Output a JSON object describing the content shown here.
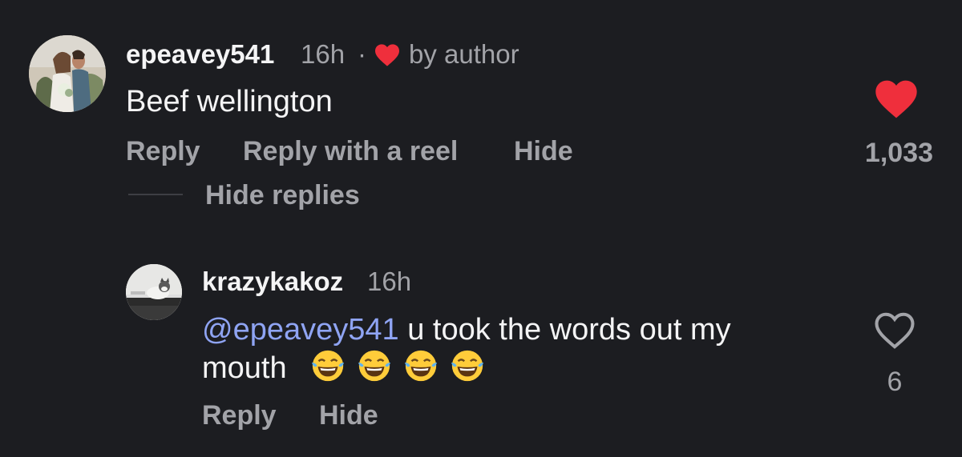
{
  "comments": [
    {
      "username": "epeavey541",
      "time": "16h",
      "separator": "·",
      "liked_by_author_label": "by author",
      "text": "Beef wellington",
      "like_count": "1,033",
      "liked": true,
      "actions": {
        "reply": "Reply",
        "reply_with_reel": "Reply with a reel",
        "hide": "Hide"
      },
      "hide_replies_label": "Hide replies"
    },
    {
      "username": "krazykakoz",
      "time": "16h",
      "mention": "@epeavey541",
      "text_line1": " u took the words out my",
      "text_line2": "mouth",
      "emojis": [
        "face-with-tears-of-joy",
        "face-with-tears-of-joy",
        "face-with-tears-of-joy",
        "face-with-tears-of-joy"
      ],
      "like_count": "6",
      "liked": false,
      "actions": {
        "reply": "Reply",
        "hide": "Hide"
      }
    }
  ],
  "colors": {
    "background": "#1c1d21",
    "primary_text": "#f4f4f5",
    "secondary_text": "#a2a3a8",
    "mention": "#8fa4f3",
    "like_red": "#ef2f3c"
  }
}
